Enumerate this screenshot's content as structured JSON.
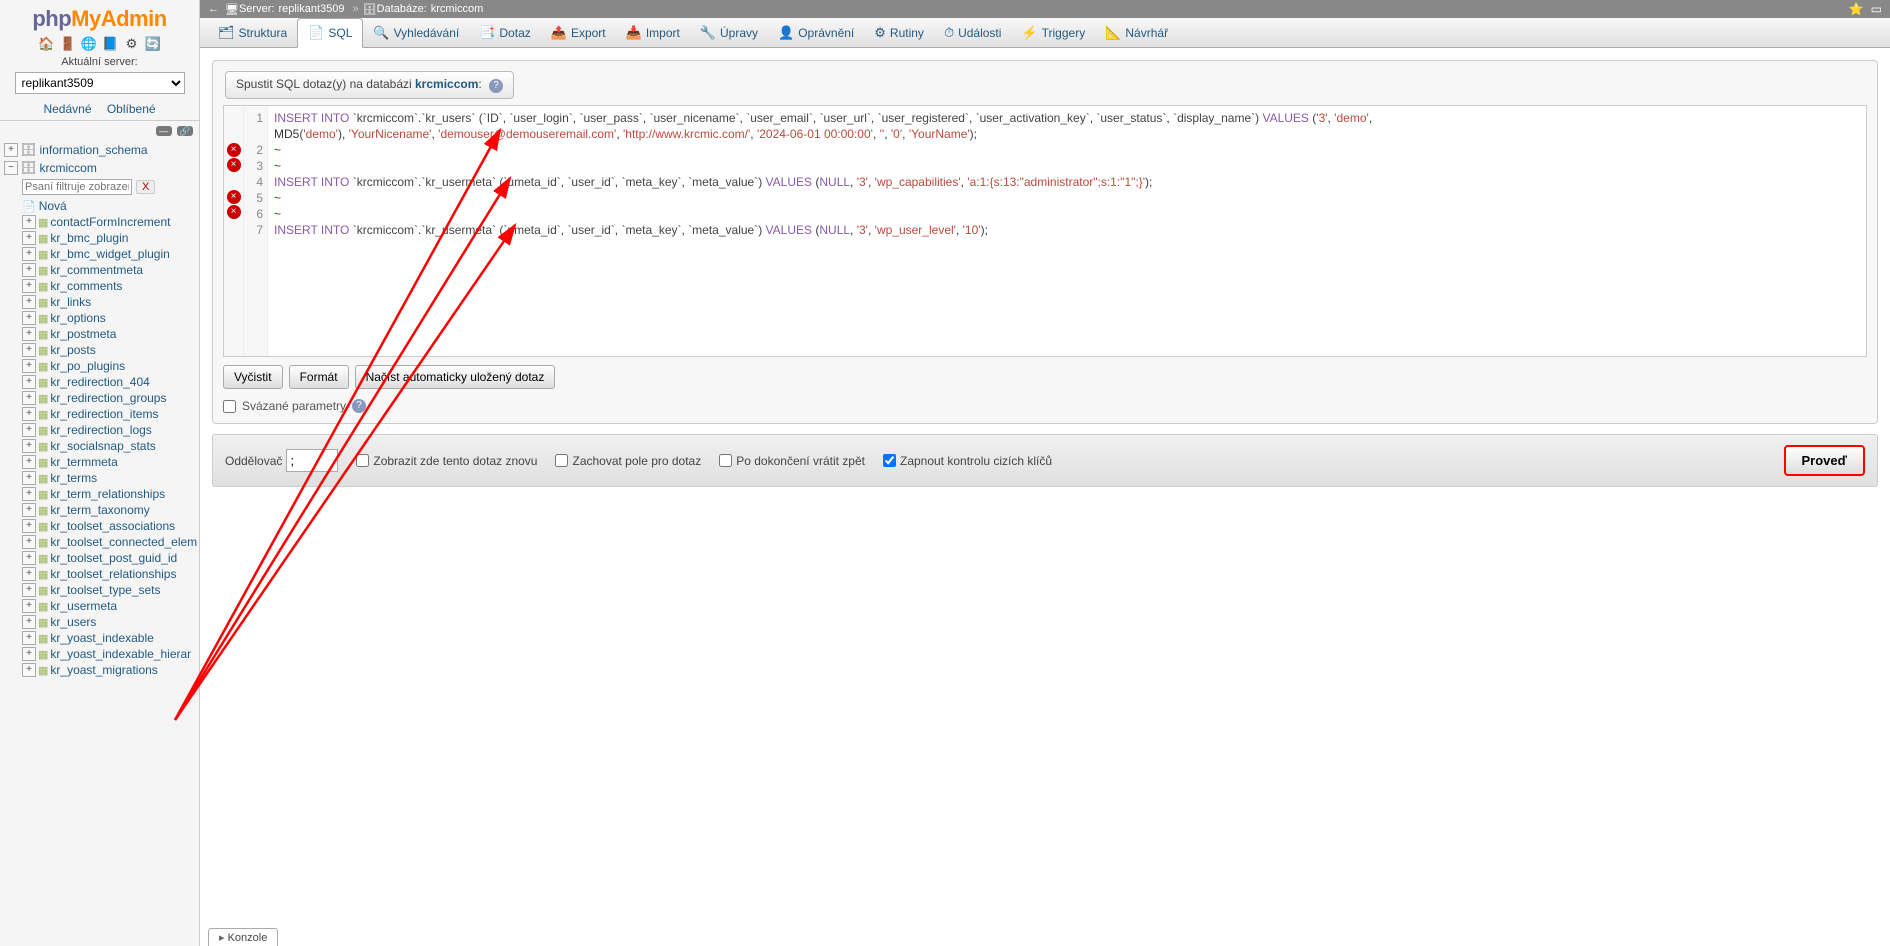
{
  "logo": {
    "part1": "php",
    "part2": "MyAdmin",
    "part3": ""
  },
  "sidebar": {
    "server_label": "Aktuální server:",
    "server_select": "replikant3509",
    "recent": "Nedávné",
    "favorites": "Oblíbené",
    "filter_placeholder": "Psaní filtruje zobrazené, E",
    "new_label": "Nová",
    "db_info_schema": "information_schema",
    "db_main": "krcmiccom",
    "tables": [
      "contactFormIncrement",
      "kr_bmc_plugin",
      "kr_bmc_widget_plugin",
      "kr_commentmeta",
      "kr_comments",
      "kr_links",
      "kr_options",
      "kr_postmeta",
      "kr_posts",
      "kr_po_plugins",
      "kr_redirection_404",
      "kr_redirection_groups",
      "kr_redirection_items",
      "kr_redirection_logs",
      "kr_socialsnap_stats",
      "kr_termmeta",
      "kr_terms",
      "kr_term_relationships",
      "kr_term_taxonomy",
      "kr_toolset_associations",
      "kr_toolset_connected_elem",
      "kr_toolset_post_guid_id",
      "kr_toolset_relationships",
      "kr_toolset_type_sets",
      "kr_usermeta",
      "kr_users",
      "kr_yoast_indexable",
      "kr_yoast_indexable_hierar",
      "kr_yoast_migrations"
    ]
  },
  "breadcrumb": {
    "server_label": "Server:",
    "server_name": "replikant3509",
    "db_label": "Databáze:",
    "db_name": "krcmiccom"
  },
  "tabs": [
    {
      "label": "Struktura",
      "icon": "🗂"
    },
    {
      "label": "SQL",
      "icon": "📄",
      "active": true
    },
    {
      "label": "Vyhledávání",
      "icon": "🔍"
    },
    {
      "label": "Dotaz",
      "icon": "📑"
    },
    {
      "label": "Export",
      "icon": "📤"
    },
    {
      "label": "Import",
      "icon": "📥"
    },
    {
      "label": "Úpravy",
      "icon": "🔧"
    },
    {
      "label": "Oprávnění",
      "icon": "👤"
    },
    {
      "label": "Rutiny",
      "icon": "⚙"
    },
    {
      "label": "Události",
      "icon": "⏱"
    },
    {
      "label": "Triggery",
      "icon": "⚡"
    },
    {
      "label": "Návrhář",
      "icon": "📐"
    }
  ],
  "sql_header": {
    "prefix": "Spustit SQL dotaz(y) na databázi ",
    "dbname": "krcmiccom",
    "suffix": ":"
  },
  "editor": {
    "line_numbers": [
      "1",
      "2",
      "3",
      "4",
      "5",
      "6",
      "7"
    ],
    "error_lines": [
      2,
      3,
      5,
      6
    ],
    "lines_html": [
      "<span class='kw'>INSERT INTO</span> <span class='bt'>`krcmiccom`</span>.<span class='bt'>`kr_users`</span> <span class='par'>(</span><span class='bt'>`ID`</span>, <span class='bt'>`user_login`</span>, <span class='bt'>`user_pass`</span>, <span class='bt'>`user_nicename`</span>, <span class='bt'>`user_email`</span>, <span class='bt'>`user_url`</span>, <span class='bt'>`user_registered`</span>, <span class='bt'>`user_activation_key`</span>, <span class='bt'>`user_status`</span>, <span class='bt'>`display_name`</span><span class='par'>)</span> <span class='kw'>VALUES</span> <span class='par'>(</span><span class='str'>'3'</span>, <span class='str'>'demo'</span>,\n<span class='id'>MD5</span><span class='par'>(</span><span class='str'>'demo'</span><span class='par'>)</span>, <span class='str'>'YourNicename'</span>, <span class='str'>'demouser@demouseremail.com'</span>, <span class='str'>'http://www.krcmic.com/'</span>, <span class='str'>'2024-06-01 00:00:00'</span>, <span class='str'>''</span>, <span class='str'>'0'</span>, <span class='str'>'YourName'</span><span class='par'>)</span>;",
      "<span class='tilde'>~</span>",
      "<span class='tilde'>~</span>",
      "<span class='kw'>INSERT INTO</span> <span class='bt'>`krcmiccom`</span>.<span class='bt'>`kr_usermeta`</span> <span class='par'>(</span><span class='bt'>`umeta_id`</span>, <span class='bt'>`user_id`</span>, <span class='bt'>`meta_key`</span>, <span class='bt'>`meta_value`</span><span class='par'>)</span> <span class='kw'>VALUES</span> <span class='par'>(</span><span class='kw'>NULL</span>, <span class='str'>'3'</span>, <span class='str'>'wp_capabilities'</span>, <span class='str'>'a:1:{s:13:\"administrator\";s:1:\"1\";}'</span><span class='par'>)</span>;",
      "<span class='tilde'>~</span>",
      "<span class='tilde'>~</span>",
      "<span class='kw'>INSERT INTO</span> <span class='bt'>`krcmiccom`</span>.<span class='bt'>`kr_usermeta`</span> <span class='par'>(</span><span class='bt'>`umeta_id`</span>, <span class='bt'>`user_id`</span>, <span class='bt'>`meta_key`</span>, <span class='bt'>`meta_value`</span><span class='par'>)</span> <span class='kw'>VALUES</span> <span class='par'>(</span><span class='kw'>NULL</span>, <span class='str'>'3'</span>, <span class='str'>'wp_user_level'</span>, <span class='str'>'10'</span><span class='par'>)</span>;"
    ]
  },
  "actions": {
    "clear": "Vyčistit",
    "format": "Formát",
    "autosave": "Načíst automaticky uložený dotaz",
    "bind_params": "Svázané parametry"
  },
  "bottom": {
    "delimiter_label": "Oddělovač",
    "delimiter_value": ";",
    "show_again": "Zobrazit zde tento dotaz znovu",
    "keep_query": "Zachovat pole pro dotaz",
    "rollback": "Po dokončení vrátit zpět",
    "fk_checks": "Zapnout kontrolu cizích klíčů",
    "submit": "Proveď"
  },
  "konsole": "Konzole"
}
